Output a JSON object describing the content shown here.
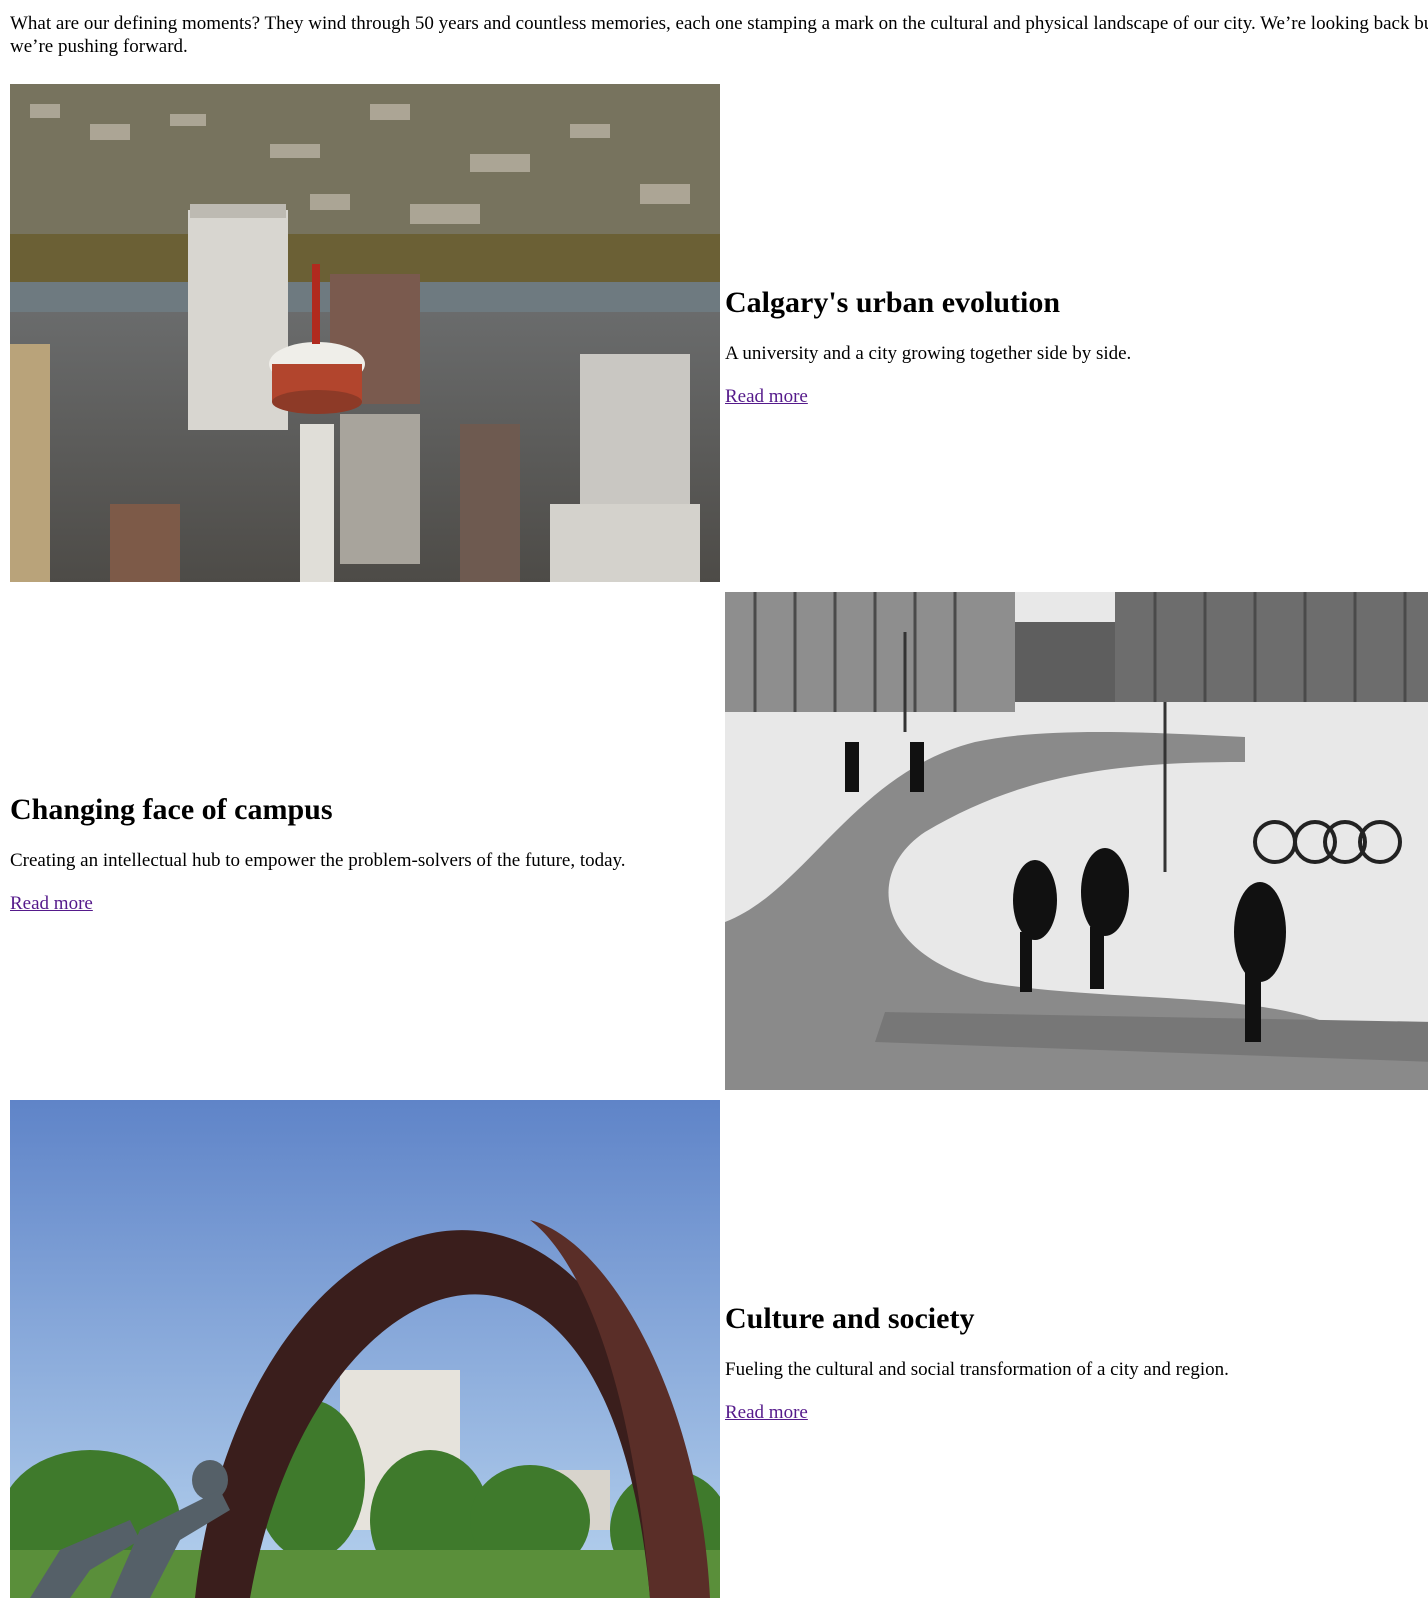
{
  "intro": {
    "text": "What are our defining moments? They wind through 50 years and countless memories, each one stamping a mark on the cultural and physical landscape of our city. We’re looking back but we’re pushing forward."
  },
  "stories": [
    {
      "title": "Calgary's urban evolution",
      "description": "A university and a city growing together side by side.",
      "link_label": "Read more",
      "image": "aerial-photo-calgary-tower-downtown"
    },
    {
      "title": "Changing face of campus",
      "description": "Creating an intellectual hub to empower the problem-solvers of the future, today.",
      "link_label": "Read more",
      "image": "black-and-white-photo-snowy-campus-students"
    },
    {
      "title": "Culture and society",
      "description": "Fueling the cultural and social transformation of a city and region.",
      "link_label": "Read more",
      "image": "photo-arch-sculpture-campus"
    }
  ],
  "colors": {
    "link": "#551a8b",
    "text": "#000000",
    "background": "#ffffff"
  }
}
